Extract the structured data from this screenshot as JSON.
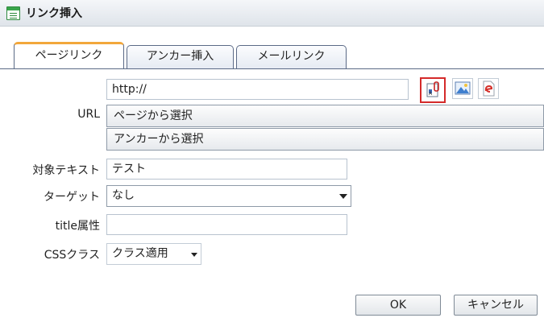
{
  "window": {
    "title": "リンク挿入"
  },
  "tabs": [
    {
      "label": "ページリンク",
      "active": true
    },
    {
      "label": "アンカー挿入",
      "active": false
    },
    {
      "label": "メールリンク",
      "active": false
    }
  ],
  "url": {
    "label": "URL",
    "value": "http://",
    "select_page": "ページから選択",
    "select_anchor": "アンカーから選択",
    "icons": [
      "link-page-icon",
      "image-icon",
      "document-icon"
    ]
  },
  "target_text": {
    "label": "対象テキスト",
    "value": "テスト"
  },
  "target": {
    "label": "ターゲット",
    "value": "なし"
  },
  "title_attr": {
    "label": "title属性",
    "value": ""
  },
  "css_class": {
    "label": "CSSクラス",
    "value": "クラス適用"
  },
  "buttons": {
    "ok": "OK",
    "cancel": "キャンセル"
  },
  "colors": {
    "active_tab_accent": "#f2a73b",
    "selected_icon_border": "#d42a2a"
  }
}
